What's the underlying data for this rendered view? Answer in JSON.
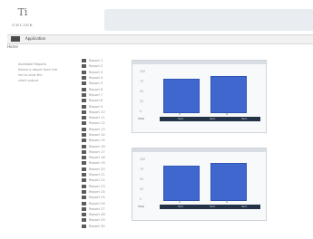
{
  "header": {
    "logo_text": "Ti",
    "logo_sub": "ONLINE"
  },
  "nav": {
    "title": "Application",
    "home": "Home"
  },
  "sidebar": {
    "info_lines": [
      "Available Reports",
      "Select a report from the",
      "list to view the",
      "chart output"
    ]
  },
  "list": {
    "items": [
      {
        "label": "Report 1"
      },
      {
        "label": "Report 2"
      },
      {
        "label": "Report 3"
      },
      {
        "label": "Report 4"
      },
      {
        "label": "Report 5"
      },
      {
        "label": "Report 6"
      },
      {
        "label": "Report 7"
      },
      {
        "label": "Report 8"
      },
      {
        "label": "Report 9"
      },
      {
        "label": "Report 10"
      },
      {
        "label": "Report 11"
      },
      {
        "label": "Report 12"
      },
      {
        "label": "Report 13"
      },
      {
        "label": "Report 14"
      },
      {
        "label": "Report 15"
      },
      {
        "label": "Report 16"
      },
      {
        "label": "Report 17"
      },
      {
        "label": "Report 18"
      },
      {
        "label": "Report 19"
      },
      {
        "label": "Report 20"
      },
      {
        "label": "Report 21"
      },
      {
        "label": "Report 22"
      },
      {
        "label": "Report 23"
      },
      {
        "label": "Report 24"
      },
      {
        "label": "Report 25"
      },
      {
        "label": "Report 26"
      },
      {
        "label": "Report 27"
      },
      {
        "label": "Report 28"
      },
      {
        "label": "Report 29"
      },
      {
        "label": "Report 30"
      }
    ]
  },
  "chart_data": [
    {
      "type": "bar",
      "title": "",
      "categories": [
        "A",
        "B"
      ],
      "values": [
        82,
        88
      ],
      "ylim": [
        0,
        100
      ],
      "yticks": [
        "100",
        "75",
        "50",
        "25",
        "0"
      ],
      "legend": "Total",
      "footer": [
        "Item",
        "Item",
        "Item"
      ],
      "color": "#3f67cd"
    },
    {
      "type": "bar",
      "title": "",
      "categories": [
        "A",
        "B"
      ],
      "values": [
        85,
        90
      ],
      "ylim": [
        0,
        100
      ],
      "yticks": [
        "100",
        "75",
        "50",
        "25",
        "0"
      ],
      "legend": "Total",
      "footer": [
        "Item",
        "Item",
        "Item"
      ],
      "color": "#3f67cd"
    }
  ]
}
